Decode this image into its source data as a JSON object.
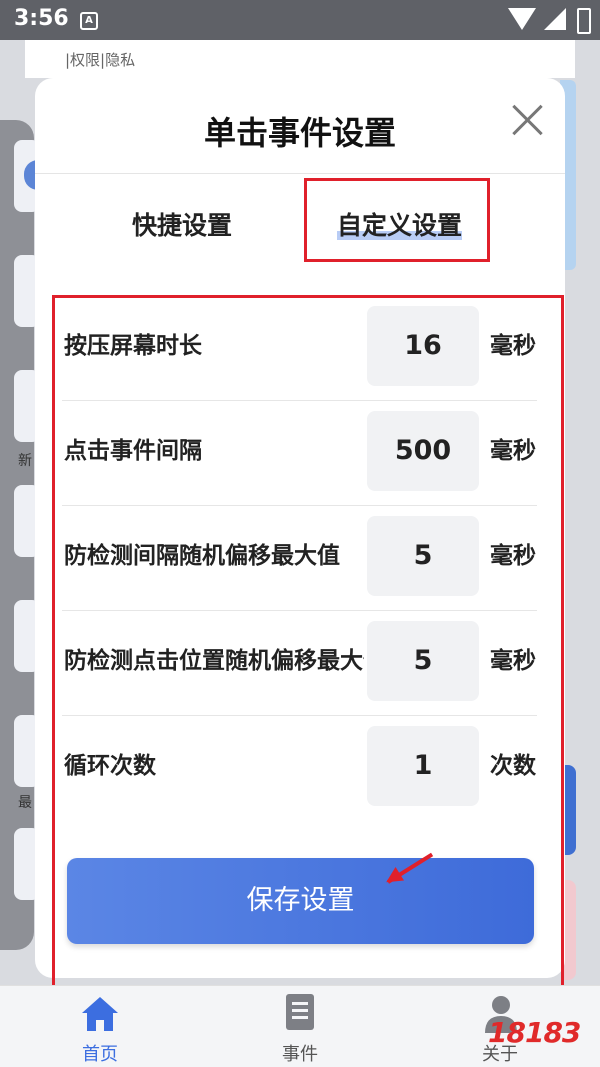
{
  "status_bar": {
    "time": "3:56",
    "notification_icon": "A"
  },
  "background": {
    "policy_text": "|权限|隐私",
    "side_label_1": "新",
    "side_label_2": "最"
  },
  "dialog": {
    "title": "单击事件设置",
    "tabs": [
      {
        "label": "快捷设置",
        "active": false
      },
      {
        "label": "自定义设置",
        "active": true
      }
    ],
    "rows": [
      {
        "label": "按压屏幕时长",
        "value": "16",
        "unit": "毫秒"
      },
      {
        "label": "点击事件间隔",
        "value": "500",
        "unit": "毫秒"
      },
      {
        "label": "防检测间隔随机偏移最大值",
        "value": "5",
        "unit": "毫秒"
      },
      {
        "label": "防检测点击位置随机偏移最大值",
        "value": "5",
        "unit": "毫秒"
      },
      {
        "label": "循环次数",
        "value": "1",
        "unit": "次数"
      }
    ],
    "save_label": "保存设置"
  },
  "bottom_nav": {
    "items": [
      {
        "label": "首页",
        "icon": "home-icon",
        "active": true
      },
      {
        "label": "事件",
        "icon": "document-icon",
        "active": false
      },
      {
        "label": "关于",
        "icon": "user-icon",
        "active": false
      }
    ]
  },
  "watermark": "18183",
  "colors": {
    "accent": "#3c6ee0",
    "highlight_red": "#e0202b",
    "tab_underline": "#b8ccf5"
  }
}
